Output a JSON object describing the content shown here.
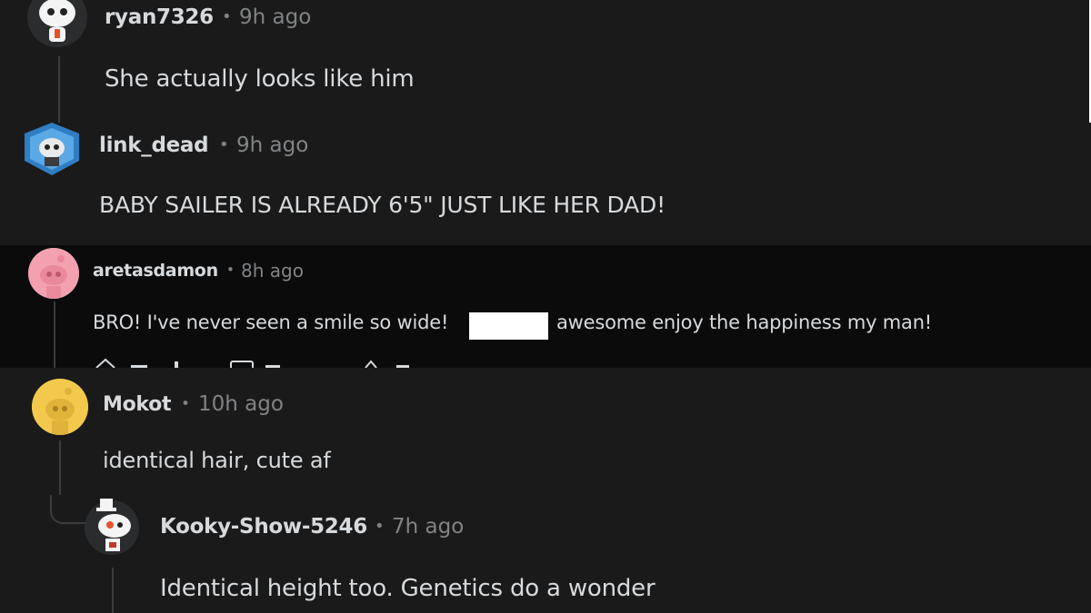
{
  "comments": [
    {
      "username": "ryan7326",
      "separator": "•",
      "time": "9h ago",
      "text": "She actually looks like him",
      "avatar": "snoo-skull-avatar-icon"
    },
    {
      "username": "link_dead",
      "separator": "•",
      "time": "9h ago",
      "text": "BABY SAILER IS ALREADY 6'5\" JUST LIKE HER DAD!",
      "avatar": "snoo-shield-avatar-icon"
    },
    {
      "username": "aretasdamon",
      "separator": "•",
      "time": "8h ago",
      "text_before": "BRO! I've never seen a smile so wide!",
      "text_after": "awesome enjoy the happiness my man!",
      "avatar": "snoo-pink-avatar-icon"
    },
    {
      "username": "Mokot",
      "separator": "•",
      "time": "10h ago",
      "text": "identical hair, cute af",
      "avatar": "snoo-yellow-avatar-icon"
    },
    {
      "username": "Kooky-Show-5246",
      "separator": "•",
      "time": "7h ago",
      "text": "Identical height too. Genetics do a wonder",
      "avatar": "snoo-tophat-avatar-icon"
    }
  ],
  "colors": {
    "background": "#1a1a1b",
    "darker_background": "#0b0b0c",
    "text": "#d7dadc",
    "meta": "#818384",
    "pink_avatar": "#f3a0b0",
    "yellow_avatar": "#f2c94c"
  }
}
